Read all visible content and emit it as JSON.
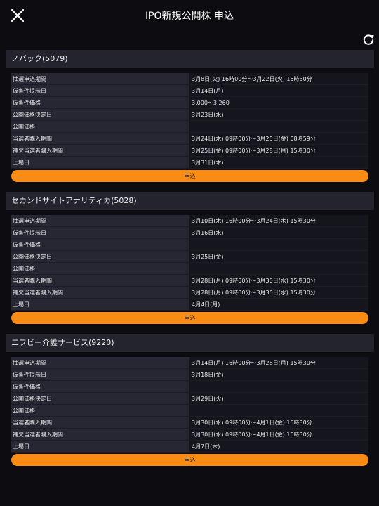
{
  "header": {
    "title": "IPO新規公開株 申込",
    "close_icon": "close-icon",
    "refresh_icon": "refresh-icon"
  },
  "colors": {
    "accent": "#f98c14",
    "background": "#0d0d11",
    "section_header": "#23242e"
  },
  "sections": [
    {
      "title": "ノバック(5079)",
      "rows": [
        {
          "label": "抽選申込期間",
          "value": "3月8日(火) 16時00分～3月22日(火) 15時30分"
        },
        {
          "label": "仮条件提示日",
          "value": "3月14日(月)"
        },
        {
          "label": "仮条件価格",
          "value": "3,000～3,260"
        },
        {
          "label": "公開価格決定日",
          "value": "3月23日(水)"
        },
        {
          "label": "公開価格",
          "value": ""
        },
        {
          "label": "当選者購入期間",
          "value": "3月24日(木) 09時00分～3月25日(金) 08時59分"
        },
        {
          "label": "補欠当選者購入期間",
          "value": "3月25日(金) 09時00分～3月28日(月) 15時30分"
        },
        {
          "label": "上場日",
          "value": "3月31日(木)"
        }
      ],
      "button": "申込"
    },
    {
      "title": "セカンドサイトアナリティカ(5028)",
      "rows": [
        {
          "label": "抽選申込期間",
          "value": "3月10日(木) 16時00分～3月24日(木) 15時30分"
        },
        {
          "label": "仮条件提示日",
          "value": "3月16日(水)"
        },
        {
          "label": "仮条件価格",
          "value": ""
        },
        {
          "label": "公開価格決定日",
          "value": "3月25日(金)"
        },
        {
          "label": "公開価格",
          "value": ""
        },
        {
          "label": "当選者購入期間",
          "value": "3月28日(月) 09時00分～3月30日(水) 15時30分"
        },
        {
          "label": "補欠当選者購入期間",
          "value": "3月28日(月) 09時00分～3月30日(水) 15時30分"
        },
        {
          "label": "上場日",
          "value": "4月4日(月)"
        }
      ],
      "button": "申込"
    },
    {
      "title": "エフビー介護サービス(9220)",
      "rows": [
        {
          "label": "抽選申込期間",
          "value": "3月14日(月) 16時00分～3月28日(月) 15時30分"
        },
        {
          "label": "仮条件提示日",
          "value": "3月18日(金)"
        },
        {
          "label": "仮条件価格",
          "value": ""
        },
        {
          "label": "公開価格決定日",
          "value": "3月29日(火)"
        },
        {
          "label": "公開価格",
          "value": ""
        },
        {
          "label": "当選者購入期間",
          "value": "3月30日(水) 09時00分～4月1日(金) 15時30分"
        },
        {
          "label": "補欠当選者購入期間",
          "value": "3月30日(水) 09時00分～4月1日(金) 15時30分"
        },
        {
          "label": "上場日",
          "value": "4月7日(木)"
        }
      ],
      "button": "申込"
    }
  ]
}
